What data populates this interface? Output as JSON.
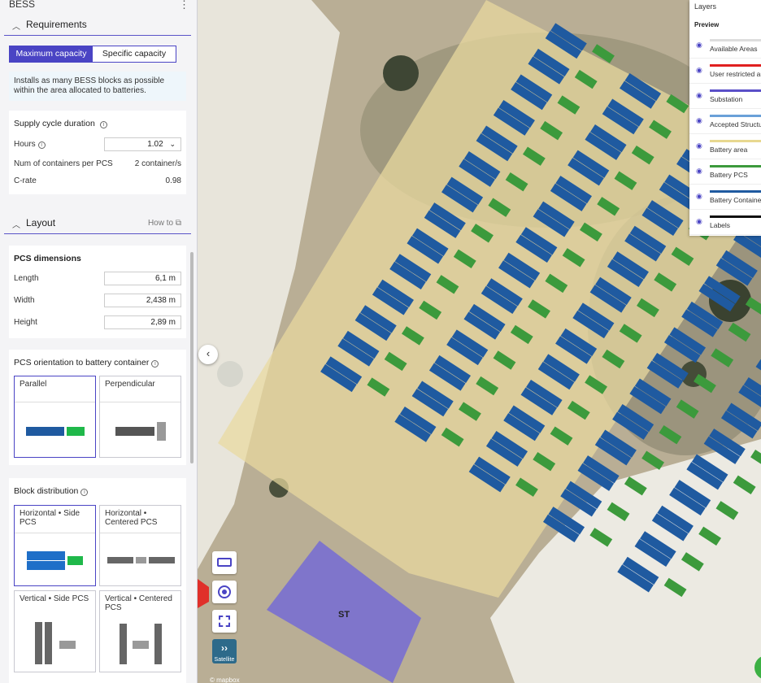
{
  "app": {
    "title": "BESS",
    "menu_icon": "kebab-icon"
  },
  "requirements": {
    "section_label": "Requirements",
    "tabs": [
      {
        "label": "Maximum capacity",
        "selected": true
      },
      {
        "label": "Specific capacity",
        "selected": false
      }
    ],
    "info_text": "Installs as many BESS blocks as possible within the area allocated to batteries.",
    "supply_cycle": {
      "title": "Supply cycle duration",
      "hours_label": "Hours",
      "hours_value": "1.02",
      "containers_label": "Num of containers per PCS",
      "containers_value": "2 container/s",
      "crate_label": "C-rate",
      "crate_value": "0.98"
    }
  },
  "layout": {
    "section_label": "Layout",
    "how_to": "How to",
    "pcs_dimensions": {
      "title": "PCS dimensions",
      "rows": [
        {
          "label": "Length",
          "value": "6,1",
          "unit": "m"
        },
        {
          "label": "Width",
          "value": "2,438",
          "unit": "m"
        },
        {
          "label": "Height",
          "value": "2,89",
          "unit": "m"
        }
      ]
    },
    "orientation": {
      "title": "PCS orientation to battery container",
      "options": [
        {
          "label": "Parallel",
          "selected": true
        },
        {
          "label": "Perpendicular",
          "selected": false
        }
      ]
    },
    "block_distribution": {
      "title": "Block distribution",
      "options": [
        {
          "label": "Horizontal • Side PCS",
          "selected": true
        },
        {
          "label": "Horizontal • Centered PCS",
          "selected": false
        },
        {
          "label": "Vertical • Side PCS",
          "selected": false
        },
        {
          "label": "Vertical • Centered PCS",
          "selected": false
        }
      ]
    }
  },
  "map": {
    "substation_label": "ST",
    "satellite_label": "Satellite",
    "attribution": "© mapbox",
    "colors": {
      "battery_area": "#e9d9a0",
      "battery_container": "#1f5aa0",
      "battery_pcs": "#3c9a3c",
      "substation": "#7a70cf",
      "available_area": "#f0efe8"
    }
  },
  "layers": {
    "title": "Layers",
    "preview": "Preview",
    "items": [
      {
        "name": "Available Areas",
        "color": "#dddddd"
      },
      {
        "name": "User restricted areas",
        "color": "#e02020"
      },
      {
        "name": "Substation",
        "color": "#5a4fc8"
      },
      {
        "name": "Accepted Structures",
        "color": "#6aa0d8"
      },
      {
        "name": "Battery area",
        "color": "#e8d890"
      },
      {
        "name": "Battery PCS",
        "color": "#3c9a3c"
      },
      {
        "name": "Battery Containers",
        "color": "#1f5aa0"
      },
      {
        "name": "Labels",
        "color": "#111111"
      }
    ]
  }
}
